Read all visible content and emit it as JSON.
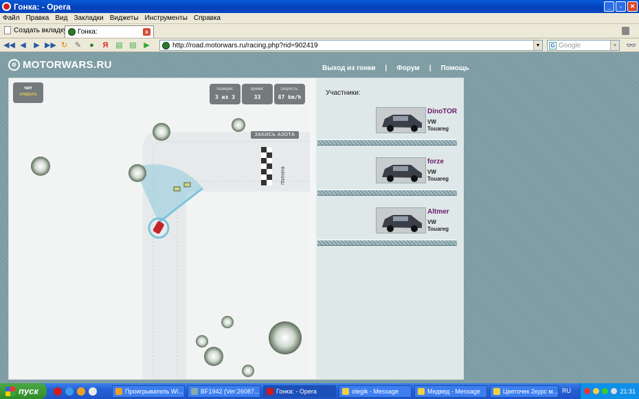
{
  "window": {
    "title": "Гонка: - Opera"
  },
  "menu": [
    "Файл",
    "Правка",
    "Вид",
    "Закладки",
    "Виджеты",
    "Инструменты",
    "Справка"
  ],
  "tabs": {
    "new_tab": "Создать вкладку",
    "active_tab": "Гонка:"
  },
  "address": {
    "url": "http://road.motorwars.ru/racing.php?rid=902419"
  },
  "search": {
    "placeholder": "Google"
  },
  "site": {
    "logo": "MOTORWARS.RU",
    "nav": [
      "Выход из гонки",
      "Форум",
      "Помощь"
    ],
    "nav_sep": "|"
  },
  "hud": {
    "cheat_title": "чит",
    "cheat_action": "открыть",
    "position_label": "позиция:",
    "position_value": "3 из 3",
    "time_label": "время:",
    "time_value": "33",
    "speed_label": "скорость:",
    "speed_value": "87 km/h",
    "nitro": "ЗАКИСЬ АЗОТА",
    "finish": "ФИНИШ"
  },
  "participants_title": "Участники:",
  "participants": [
    {
      "name": "DinoTOR",
      "car_make": "VW",
      "car_model": "Touareg"
    },
    {
      "name": "forze",
      "car_make": "VW",
      "car_model": "Touareg"
    },
    {
      "name": "Altmer",
      "car_make": "VW",
      "car_model": "Touareg"
    }
  ],
  "taskbar": {
    "start": "пуск",
    "tasks": [
      "Проигрыватель Wi...",
      "BF1942 (Ver:26087...",
      "Гонка: - Opera",
      "olegik - Message",
      "Медвед - Message",
      "Цветочек 2курс м..."
    ],
    "active_task": 2,
    "lang": "RU",
    "clock": "21:31"
  },
  "colors": {
    "title_blue": "#0a59d6",
    "site_bg": "#7d9ca3",
    "participant_name": "#6a1a6a",
    "taskbar_blue": "#2561d6"
  }
}
